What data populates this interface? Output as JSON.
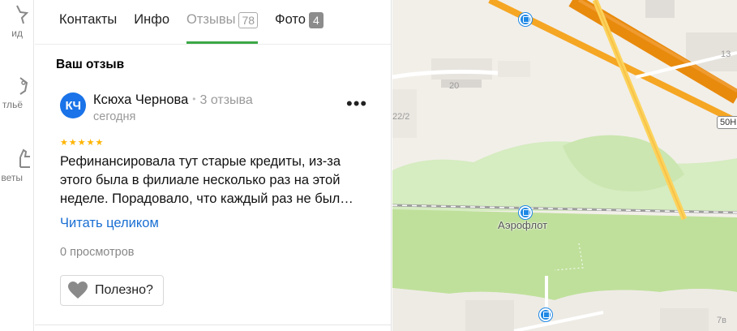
{
  "rail": {
    "items": [
      {
        "label": "ид",
        "icon": "star-icon"
      },
      {
        "label": "тльё",
        "icon": "shop-icon"
      },
      {
        "label": "веты",
        "icon": "thumb-icon"
      }
    ]
  },
  "tabs": [
    {
      "label": "Контакты"
    },
    {
      "label": "Инфо"
    },
    {
      "label": "Отзывы",
      "count": "78"
    },
    {
      "label": "Фото",
      "count": "4"
    }
  ],
  "review": {
    "section_title": "Ваш отзыв",
    "avatar_initials": "КЧ",
    "author": "Ксюха Чернова",
    "review_count": "3 отзыва",
    "date": "сегодня",
    "more": "•••",
    "rating": 5,
    "text": "Рефинансировала тут старые кредиты, из-за этого была в филиале несколько раз на этой неделе. Порадовало, что каждый раз не был…",
    "read_more": "Читать целиком",
    "views": "0 просмотров",
    "useful_label": "Полезно?"
  },
  "map": {
    "labels": [
      "20",
      "22/2",
      "13",
      "7в"
    ],
    "road_badge": "50Н",
    "stop_name": "Аэрофлот"
  },
  "colors": {
    "accent_green": "#3ca846",
    "link_blue": "#1a6fd3",
    "avatar_blue": "#1a73e8",
    "star_gold": "#ffb400",
    "map_park": "#c5e3a3",
    "map_road": "#f5a623"
  }
}
